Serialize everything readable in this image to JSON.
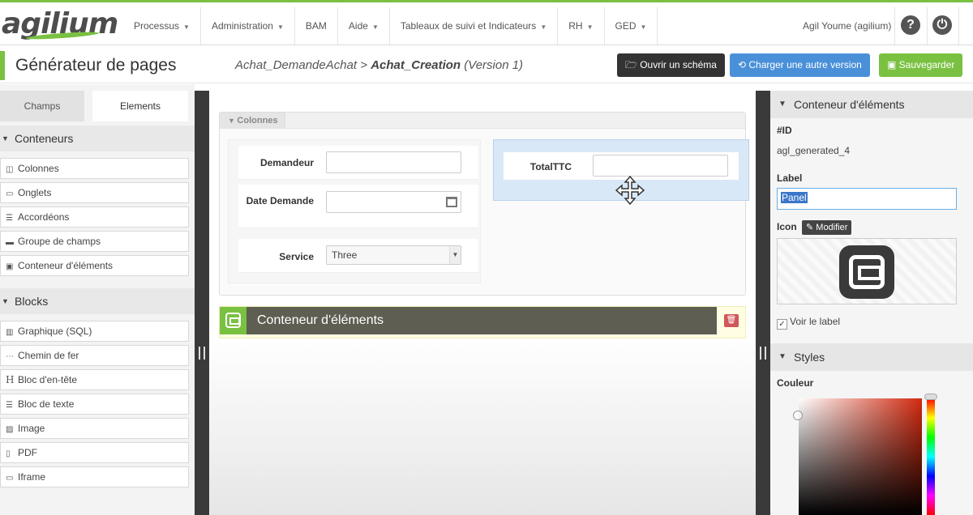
{
  "app": {
    "logo": "agilium",
    "menu": [
      "Processus",
      "Administration",
      "BAM",
      "Aide",
      "Tableaux de suivi et Indicateurs",
      "RH",
      "GED"
    ],
    "menu_has_caret": [
      true,
      true,
      false,
      true,
      true,
      true,
      true
    ],
    "user": "Agil Youme (agilium)",
    "help_icon": "question-icon",
    "power_icon": "power-icon"
  },
  "header": {
    "title": "Générateur de pages",
    "breadcrumb_process": "Achat_DemandeAchat",
    "breadcrumb_sep": ">",
    "breadcrumb_step": "Achat_Creation",
    "breadcrumb_version": "(Version 1)",
    "btn_open": "Ouvrir un schéma",
    "btn_load": "Charger une autre version",
    "btn_save": "Sauvegarder"
  },
  "left": {
    "tabs": [
      "Champs",
      "Elements"
    ],
    "active_tab": "Elements",
    "containers_title": "Conteneurs",
    "containers": [
      {
        "label": "Colonnes",
        "icon": "columns-icon"
      },
      {
        "label": "Onglets",
        "icon": "folder-icon"
      },
      {
        "label": "Accordéons",
        "icon": "list-icon"
      },
      {
        "label": "Groupe de champs",
        "icon": "window-icon"
      },
      {
        "label": "Conteneur d'éléments",
        "icon": "container-icon"
      }
    ],
    "blocks_title": "Blocks",
    "blocks": [
      {
        "label": "Graphique (SQL)",
        "icon": "bar-chart-icon"
      },
      {
        "label": "Chemin de fer",
        "icon": "ellipsis-icon"
      },
      {
        "label": "Bloc d'en-tête",
        "icon": "heading-icon"
      },
      {
        "label": "Bloc de texte",
        "icon": "text-icon"
      },
      {
        "label": "Image",
        "icon": "image-icon"
      },
      {
        "label": "PDF",
        "icon": "file-icon"
      },
      {
        "label": "Iframe",
        "icon": "iframe-icon"
      }
    ]
  },
  "canvas": {
    "columns_label": "Colonnes",
    "fields": [
      {
        "label": "Demandeur",
        "value": ""
      },
      {
        "label": "Date Demande",
        "value": ""
      },
      {
        "label": "Service",
        "value": "Three"
      }
    ],
    "right_field": {
      "label": "TotalTTC",
      "value": ""
    },
    "container_title": "Conteneur d'éléments"
  },
  "right": {
    "section_title": "Conteneur d'éléments",
    "id_label": "#ID",
    "id_value": "agl_generated_4",
    "label_label": "Label",
    "label_value": "Panel",
    "icon_label": "Icon",
    "modify_btn": "Modifier",
    "show_label": "Voir le label",
    "show_label_checked": true,
    "styles_title": "Styles",
    "color_label": "Couleur"
  },
  "colors": {
    "brand_green": "#7ac142",
    "blue": "#4a90d9",
    "dark": "#333333"
  }
}
